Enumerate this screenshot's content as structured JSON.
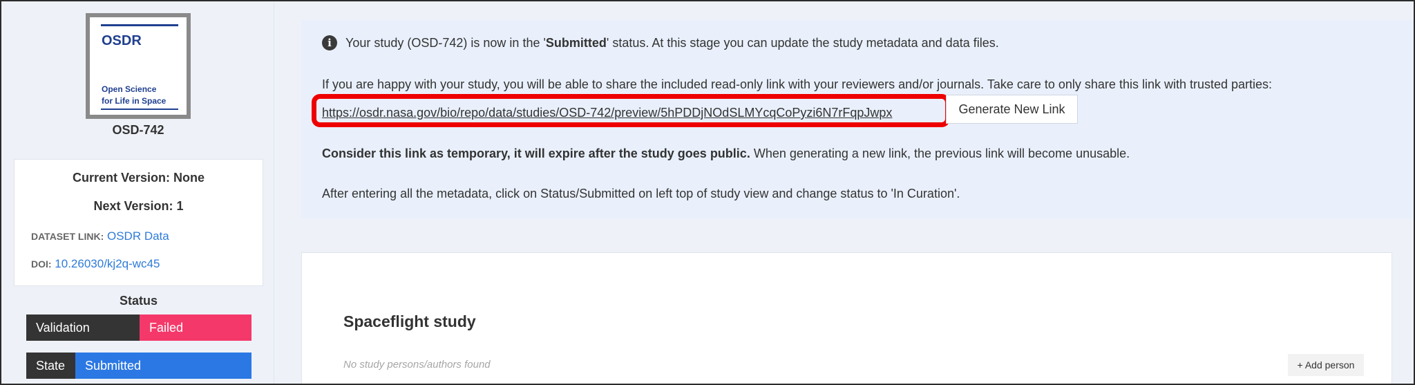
{
  "sidebar": {
    "logo": {
      "title": "OSDR",
      "tagline_line1": "Open Science",
      "tagline_line2": "for Life in Space"
    },
    "study_id": "OSD-742",
    "version": {
      "current": "Current Version: None",
      "next": "Next Version: 1",
      "dataset_link_label": "DATASET LINK:",
      "dataset_link_text": "OSDR Data",
      "doi_label": "DOI:",
      "doi_value": "10.26030/kj2q-wc45"
    },
    "status": {
      "title": "Status",
      "validation_label": "Validation",
      "validation_value": "Failed",
      "state_label": "State",
      "state_value": "Submitted"
    }
  },
  "notice": {
    "line1_prefix": "Your study (OSD-742) is now in the '",
    "line1_status": "Submitted",
    "line1_suffix": "' status. At this stage you can update the study metadata and data files.",
    "share_text": "If you are happy with your study, you will be able to share the included read-only link with your reviewers and/or journals. Take care to only share this link with trusted parties:",
    "preview_url": "https://osdr.nasa.gov/bio/repo/data/studies/OSD-742/preview/5hPDDjNOdSLMYcqCoPyzi6N7rFqpJwpx",
    "generate_button": "Generate New Link",
    "consider_bold": "Consider this link as temporary, it will expire after the study goes public.",
    "consider_rest": " When generating a new link, the previous link will become unusable.",
    "after_text": "After entering all the metadata, click on Status/Submitted on left top of study view and change status to 'In Curation'."
  },
  "study": {
    "title": "Spaceflight study",
    "no_persons": "No study persons/authors found",
    "add_person_button": "+ Add person"
  },
  "colors": {
    "failed": "#f5386a",
    "submitted": "#2b78e4",
    "link": "#2e7bd9",
    "highlight": "#ee0000"
  }
}
